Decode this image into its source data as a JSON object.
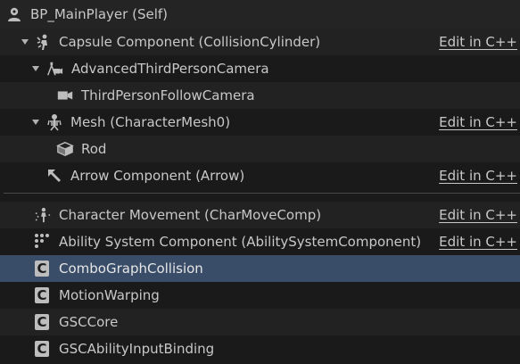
{
  "root": {
    "label": "BP_MainPlayer (Self)",
    "icon": "actor-self-icon"
  },
  "edit_label": "Edit in C++",
  "scene_components": [
    {
      "label": "Capsule Component (CollisionCylinder)",
      "icon": "capsule-icon",
      "expanded": true,
      "has_edit": true
    },
    {
      "label": "AdvancedThirdPersonCamera",
      "icon": "camera-rig-icon",
      "expanded": true,
      "has_edit": false
    },
    {
      "label": "ThirdPersonFollowCamera",
      "icon": "camera-icon",
      "expanded": false,
      "has_edit": false
    },
    {
      "label": "Mesh (CharacterMesh0)",
      "icon": "skeleton-icon",
      "expanded": true,
      "has_edit": true
    },
    {
      "label": "Rod",
      "icon": "static-mesh-icon",
      "expanded": false,
      "has_edit": false
    },
    {
      "label": "Arrow Component (Arrow)",
      "icon": "arrow-component-icon",
      "expanded": false,
      "has_edit": true
    }
  ],
  "actor_components": [
    {
      "label": "Character Movement (CharMoveComp)",
      "icon": "character-movement-icon",
      "has_edit": true,
      "selected": false
    },
    {
      "label": "Ability System Component (AbilitySystemComponent)",
      "icon": "ability-system-icon",
      "has_edit": true,
      "selected": false
    },
    {
      "label": "ComboGraphCollision",
      "icon": "cpp-class-icon",
      "has_edit": false,
      "selected": true
    },
    {
      "label": "MotionWarping",
      "icon": "cpp-class-icon",
      "has_edit": false,
      "selected": false
    },
    {
      "label": "GSCCore",
      "icon": "cpp-class-icon",
      "has_edit": false,
      "selected": false
    },
    {
      "label": "GSCAbilityInputBinding",
      "icon": "cpp-class-icon",
      "has_edit": false,
      "selected": false
    }
  ],
  "colors": {
    "background": "#1a1a1a",
    "row_alt": "#222222",
    "selected": "#3a4d68",
    "text": "#c8c8c8"
  }
}
